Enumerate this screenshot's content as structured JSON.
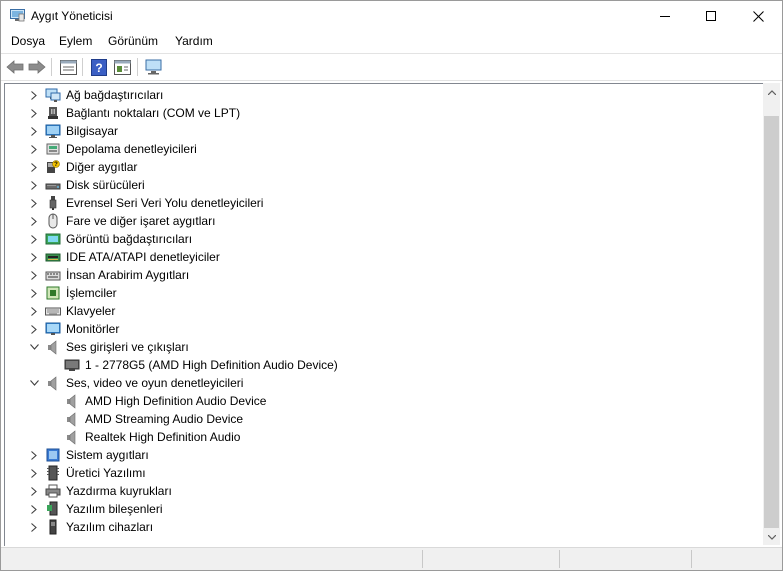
{
  "window": {
    "title": "Aygıt Yöneticisi"
  },
  "menu": [
    "Dosya",
    "Eylem",
    "Görünüm",
    "Yardım"
  ],
  "tree": [
    {
      "label": "Ağ bağdaştırıcıları",
      "icon": "network-adapter-icon",
      "level": 0,
      "expanded": false
    },
    {
      "label": "Bağlantı noktaları (COM ve LPT)",
      "icon": "port-icon",
      "level": 0,
      "expanded": false
    },
    {
      "label": "Bilgisayar",
      "icon": "computer-icon",
      "level": 0,
      "expanded": false
    },
    {
      "label": "Depolama denetleyicileri",
      "icon": "storage-controller-icon",
      "level": 0,
      "expanded": false
    },
    {
      "label": "Diğer aygıtlar",
      "icon": "other-devices-icon",
      "level": 0,
      "expanded": false
    },
    {
      "label": "Disk sürücüleri",
      "icon": "disk-drive-icon",
      "level": 0,
      "expanded": false
    },
    {
      "label": "Evrensel Seri Veri Yolu denetleyicileri",
      "icon": "usb-icon",
      "level": 0,
      "expanded": false
    },
    {
      "label": "Fare ve diğer işaret aygıtları",
      "icon": "mouse-icon",
      "level": 0,
      "expanded": false
    },
    {
      "label": "Görüntü bağdaştırıcıları",
      "icon": "display-adapter-icon",
      "level": 0,
      "expanded": false
    },
    {
      "label": "IDE ATA/ATAPI denetleyiciler",
      "icon": "ide-icon",
      "level": 0,
      "expanded": false
    },
    {
      "label": "İnsan Arabirim Aygıtları",
      "icon": "hid-icon",
      "level": 0,
      "expanded": false
    },
    {
      "label": "İşlemciler",
      "icon": "processor-icon",
      "level": 0,
      "expanded": false
    },
    {
      "label": "Klavyeler",
      "icon": "keyboard-icon",
      "level": 0,
      "expanded": false
    },
    {
      "label": "Monitörler",
      "icon": "monitor-icon",
      "level": 0,
      "expanded": false
    },
    {
      "label": "Ses girişleri ve çıkışları",
      "icon": "speaker-icon",
      "level": 0,
      "expanded": true
    },
    {
      "label": "1 - 2778G5 (AMD High Definition Audio Device)",
      "icon": "monitor-device-icon",
      "level": 1
    },
    {
      "label": "Ses, video ve oyun denetleyicileri",
      "icon": "speaker-icon",
      "level": 0,
      "expanded": true
    },
    {
      "label": "AMD High Definition Audio Device",
      "icon": "speaker-icon",
      "level": 1
    },
    {
      "label": "AMD Streaming Audio Device",
      "icon": "speaker-icon",
      "level": 1
    },
    {
      "label": "Realtek High Definition Audio",
      "icon": "speaker-icon",
      "level": 1
    },
    {
      "label": "Sistem aygıtları",
      "icon": "system-devices-icon",
      "level": 0,
      "expanded": false
    },
    {
      "label": "Üretici Yazılımı",
      "icon": "firmware-icon",
      "level": 0,
      "expanded": false
    },
    {
      "label": "Yazdırma kuyrukları",
      "icon": "print-queue-icon",
      "level": 0,
      "expanded": false
    },
    {
      "label": "Yazılım bileşenleri",
      "icon": "software-component-icon",
      "level": 0,
      "expanded": false
    },
    {
      "label": "Yazılım cihazları",
      "icon": "software-device-icon",
      "level": 0,
      "expanded": false
    }
  ],
  "toolbar": [
    "back-icon",
    "forward-icon",
    "properties-icon",
    "help-icon",
    "show-hidden-icon",
    "scan-hardware-icon"
  ]
}
